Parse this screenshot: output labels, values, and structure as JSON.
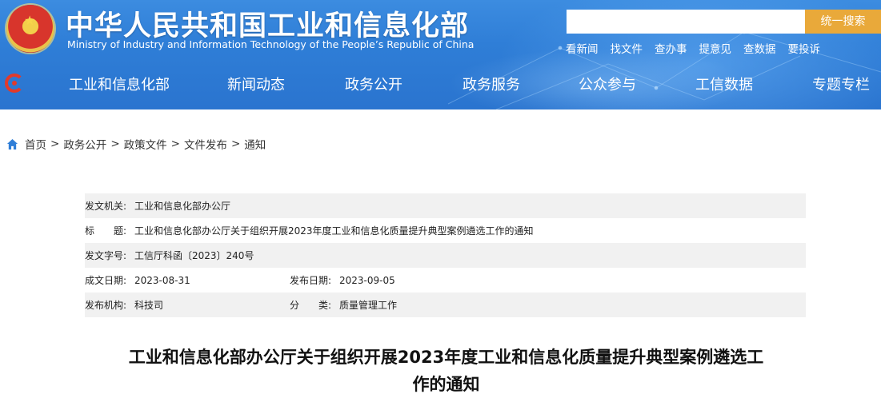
{
  "header": {
    "title": "中华人民共和国工业和信息化部",
    "subtitle": "Ministry of Industry and Information Technology of the People’s Republic of China",
    "search_placeholder": "",
    "search_button": "统一搜索",
    "quick_links": [
      "看新闻",
      "找文件",
      "查办事",
      "提意见",
      "查数据",
      "要投诉"
    ]
  },
  "nav": {
    "items": [
      "工业和信息化部",
      "新闻动态",
      "政务公开",
      "政务服务",
      "公众参与",
      "工信数据",
      "专题专栏"
    ]
  },
  "breadcrumb": {
    "items": [
      "首页",
      "政务公开",
      "政策文件",
      "文件发布",
      "通知"
    ],
    "separator": ">"
  },
  "info": {
    "issuer_label": "发文机关:",
    "issuer": "工业和信息化部办公厅",
    "title_label": "标　　题:",
    "title": "工业和信息化部办公厅关于组织开展2023年度工业和信息化质量提升典型案例遴选工作的通知",
    "doc_no_label": "发文字号:",
    "doc_no": "工信厅科函〔2023〕240号",
    "date_written_label": "成文日期:",
    "date_written": "2023-08-31",
    "date_published_label": "发布日期:",
    "date_published": "2023-09-05",
    "agency_label": "发布机构:",
    "agency": "科技司",
    "category_label": "分　　类:",
    "category": "质量管理工作"
  },
  "document": {
    "title_line1": "工业和信息化部办公厅关于组织开展2023年度工业和信息化质量提升典型案例遴选工",
    "title_line2": "作的通知"
  }
}
